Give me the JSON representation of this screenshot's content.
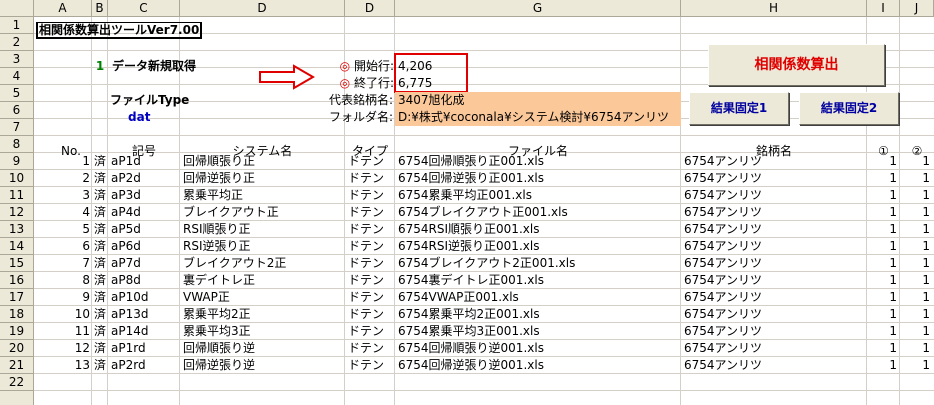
{
  "columns": [
    "A",
    "B",
    "C",
    "D",
    "E",
    "G",
    "H",
    "I",
    "J"
  ],
  "row_numbers": [
    "1",
    "2",
    "3",
    "4",
    "5",
    "6",
    "7",
    "8",
    "9",
    "10",
    "11",
    "12",
    "13",
    "14",
    "15",
    "16",
    "17",
    "18",
    "19",
    "20",
    "21",
    "22"
  ],
  "title": "相関係数算出ツールVer7.00",
  "data_new": {
    "num": "1",
    "label": "データ新規取得"
  },
  "start_row": {
    "marker": "◎",
    "label": "開始行:",
    "value": "4,206"
  },
  "end_row": {
    "marker": "◎",
    "label": "終了行:",
    "value": "6,775"
  },
  "file_type": {
    "label": "ファイルType",
    "value": "dat"
  },
  "rep_name": {
    "label": "代表銘柄名:",
    "value": "3407旭化成"
  },
  "folder": {
    "label": "フォルダ名:",
    "value": "D:¥株式¥coconala¥システム検討¥6754アンリツ"
  },
  "buttons": {
    "calc": "相関係数算出",
    "fix1": "結果固定1",
    "fix2": "結果固定2"
  },
  "headers": {
    "no": "No.",
    "code": "記号",
    "system": "システム名",
    "type": "タイプ",
    "file": "ファイル名",
    "stock": "銘柄名",
    "c1": "①",
    "c2": "②"
  },
  "colors": {
    "orange": "#fbc89a",
    "red": "#e00000",
    "blue": "#0000c0",
    "green": "#008000"
  },
  "rows": [
    {
      "no": "1",
      "done": "済",
      "code": "aP1d",
      "system": "回帰順張り正",
      "type": "ドテン",
      "file": "6754回帰順張り正001.xls",
      "stock": "6754アンリツ",
      "c1": "1",
      "c2": "1"
    },
    {
      "no": "2",
      "done": "済",
      "code": "aP2d",
      "system": "回帰逆張り正",
      "type": "ドテン",
      "file": "6754回帰逆張り正001.xls",
      "stock": "6754アンリツ",
      "c1": "1",
      "c2": "1"
    },
    {
      "no": "3",
      "done": "済",
      "code": "aP3d",
      "system": "累乗平均正",
      "type": "ドテン",
      "file": "6754累乗平均正001.xls",
      "stock": "6754アンリツ",
      "c1": "1",
      "c2": "1"
    },
    {
      "no": "4",
      "done": "済",
      "code": "aP4d",
      "system": "ブレイクアウト正",
      "type": "ドテン",
      "file": "6754ブレイクアウト正001.xls",
      "stock": "6754アンリツ",
      "c1": "1",
      "c2": "1"
    },
    {
      "no": "5",
      "done": "済",
      "code": "aP5d",
      "system": "RSI順張り正",
      "type": "ドテン",
      "file": "6754RSI順張り正001.xls",
      "stock": "6754アンリツ",
      "c1": "1",
      "c2": "1"
    },
    {
      "no": "6",
      "done": "済",
      "code": "aP6d",
      "system": "RSI逆張り正",
      "type": "ドテン",
      "file": "6754RSI逆張り正001.xls",
      "stock": "6754アンリツ",
      "c1": "1",
      "c2": "1"
    },
    {
      "no": "7",
      "done": "済",
      "code": "aP7d",
      "system": "ブレイクアウト2正",
      "type": "ドテン",
      "file": "6754ブレイクアウト2正001.xls",
      "stock": "6754アンリツ",
      "c1": "1",
      "c2": "1"
    },
    {
      "no": "8",
      "done": "済",
      "code": "aP8d",
      "system": "裏デイトレ正",
      "type": "ドテン",
      "file": "6754裏デイトレ正001.xls",
      "stock": "6754アンリツ",
      "c1": "1",
      "c2": "1"
    },
    {
      "no": "9",
      "done": "済",
      "code": "aP10d",
      "system": "VWAP正",
      "type": "ドテン",
      "file": "6754VWAP正001.xls",
      "stock": "6754アンリツ",
      "c1": "1",
      "c2": "1"
    },
    {
      "no": "10",
      "done": "済",
      "code": "aP13d",
      "system": "累乗平均2正",
      "type": "ドテン",
      "file": "6754累乗平均2正001.xls",
      "stock": "6754アンリツ",
      "c1": "1",
      "c2": "1"
    },
    {
      "no": "11",
      "done": "済",
      "code": "aP14d",
      "system": "累乗平均3正",
      "type": "ドテン",
      "file": "6754累乗平均3正001.xls",
      "stock": "6754アンリツ",
      "c1": "1",
      "c2": "1"
    },
    {
      "no": "12",
      "done": "済",
      "code": "aP1rd",
      "system": "回帰順張り逆",
      "type": "ドテン",
      "file": "6754回帰順張り逆001.xls",
      "stock": "6754アンリツ",
      "c1": "1",
      "c2": "1"
    },
    {
      "no": "13",
      "done": "済",
      "code": "aP2rd",
      "system": "回帰逆張り逆",
      "type": "ドテン",
      "file": "6754回帰逆張り逆001.xls",
      "stock": "6754アンリツ",
      "c1": "1",
      "c2": "1"
    }
  ]
}
